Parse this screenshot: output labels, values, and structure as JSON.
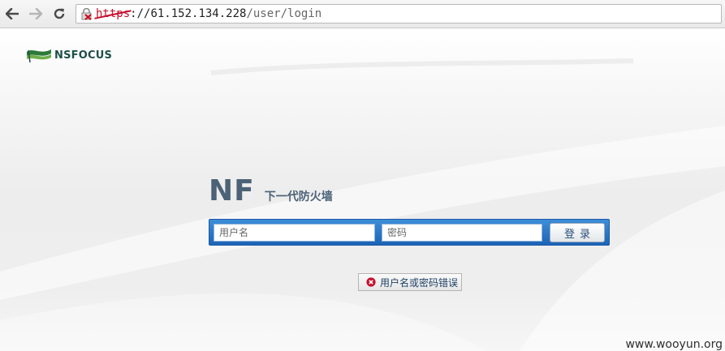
{
  "browser": {
    "url_scheme": "https",
    "url_host": "://61.152.134.228",
    "url_path": "/user/login"
  },
  "brand": {
    "name": "NSFOCUS"
  },
  "product": {
    "logo_text": "NF",
    "subtitle": "下一代防火墙"
  },
  "login": {
    "username_placeholder": "用户名",
    "password_placeholder": "密码",
    "submit_label": "登录"
  },
  "error": {
    "message": "用户名或密码错误"
  },
  "watermark": "www.wooyun.org",
  "colors": {
    "accent_blue": "#1d63b5",
    "brand_green": "#1f4f47",
    "error_red": "#c8102e"
  }
}
